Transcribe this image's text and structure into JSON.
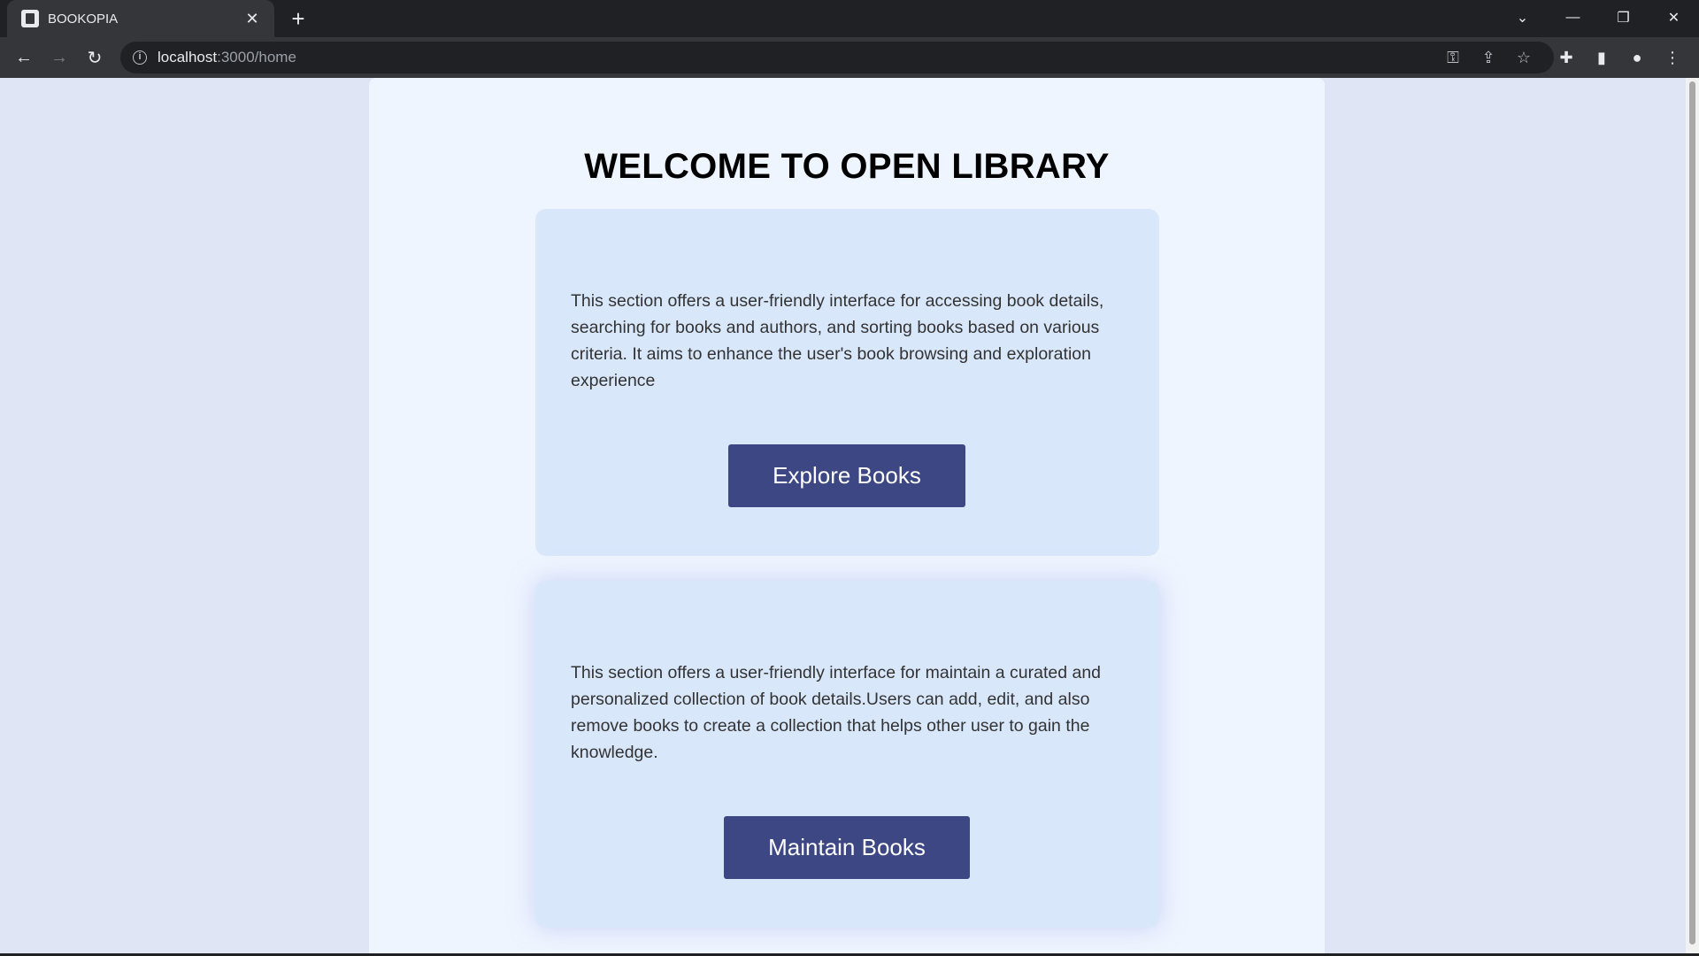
{
  "browser": {
    "tab_title": "BOOKOPIA",
    "url_host": "localhost",
    "url_rest": ":3000/home"
  },
  "page": {
    "title": "WELCOME TO OPEN LIBRARY",
    "sections": [
      {
        "description": "This section offers a user-friendly interface for accessing book details, searching for books and authors, and sorting books based on various criteria. It aims to enhance the user's book browsing and exploration experience",
        "button_label": "Explore Books"
      },
      {
        "description": "This section offers a user-friendly interface for maintain a curated and personalized collection of book details.Users can add, edit, and also remove books to create a collection that helps other user to gain the knowledge.",
        "button_label": "Maintain Books"
      }
    ]
  },
  "colors": {
    "page_bg": "#dfe5f5",
    "container_bg": "#eff5fe",
    "card_bg": "#d9e7fb",
    "button_bg": "#3d4784"
  }
}
